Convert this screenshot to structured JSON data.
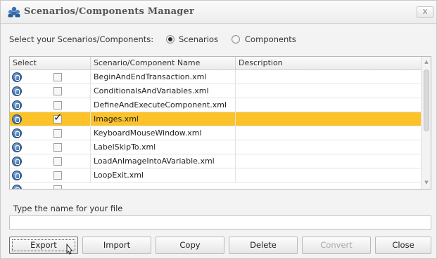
{
  "window": {
    "title": "Scenarios/Components Manager",
    "close_glyph": "x"
  },
  "selector": {
    "label": "Select your Scenarios/Components:",
    "options": [
      {
        "label": "Scenarios",
        "selected": true
      },
      {
        "label": "Components",
        "selected": false
      }
    ]
  },
  "grid": {
    "columns": [
      "Select",
      "Scenario/Component Name",
      "Description"
    ],
    "rows": [
      {
        "icon": "scenario-icon",
        "checked": false,
        "name": "BeginAndEndTransaction.xml",
        "description": "",
        "selected": false
      },
      {
        "icon": "scenario-icon",
        "checked": false,
        "name": "ConditionalsAndVariables.xml",
        "description": "",
        "selected": false
      },
      {
        "icon": "scenario-icon",
        "checked": false,
        "name": "DefineAndExecuteComponent.xml",
        "description": "",
        "selected": false
      },
      {
        "icon": "scenario-icon",
        "checked": true,
        "name": "Images.xml",
        "description": "",
        "selected": true
      },
      {
        "icon": "scenario-icon",
        "checked": false,
        "name": "KeyboardMouseWindow.xml",
        "description": "",
        "selected": false
      },
      {
        "icon": "scenario-icon",
        "checked": false,
        "name": "LabelSkipTo.xml",
        "description": "",
        "selected": false
      },
      {
        "icon": "scenario-icon",
        "checked": false,
        "name": "LoadAnImageIntoAVariable.xml",
        "description": "",
        "selected": false
      },
      {
        "icon": "scenario-icon",
        "checked": false,
        "name": "LoopExit.xml",
        "description": "",
        "selected": false
      }
    ],
    "highlight_color": "#fbc22a",
    "check_glyph": "✓"
  },
  "file": {
    "label": "Type the name for your file",
    "value": ""
  },
  "buttons": {
    "export": "Export",
    "import": "Import",
    "copy": "Copy",
    "delete": "Delete",
    "convert": "Convert",
    "close": "Close"
  }
}
